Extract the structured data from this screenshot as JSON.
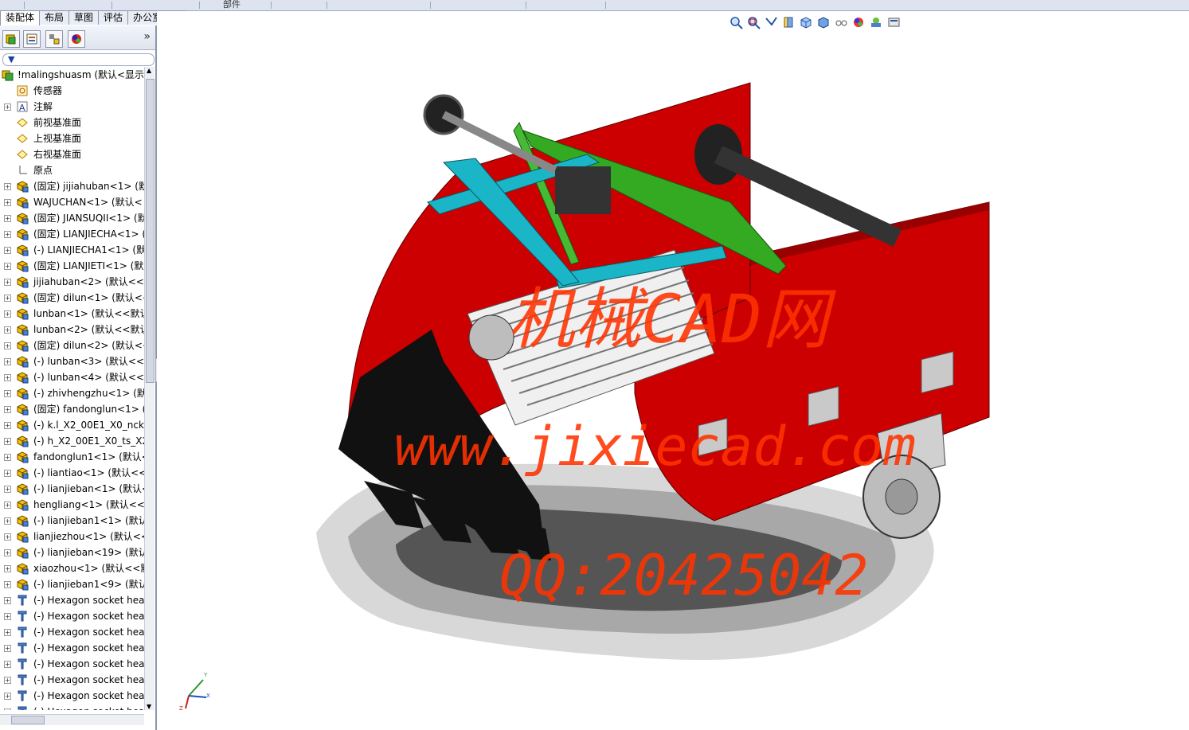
{
  "menu_strip": {
    "label": "部件"
  },
  "tabs": [
    {
      "label": "装配体",
      "active": true
    },
    {
      "label": "布局",
      "active": false
    },
    {
      "label": "草图",
      "active": false
    },
    {
      "label": "评估",
      "active": false
    },
    {
      "label": "办公室产品",
      "active": false
    }
  ],
  "tree": {
    "root": "!malingshuasm  (默认<显示",
    "items": [
      {
        "label": "传感器",
        "icon": "sensor-icon",
        "expand": false
      },
      {
        "label": "注解",
        "icon": "annotation-icon",
        "expand": true
      },
      {
        "label": "前视基准面",
        "icon": "plane-icon",
        "expand": false
      },
      {
        "label": "上视基准面",
        "icon": "plane-icon",
        "expand": false
      },
      {
        "label": "右视基准面",
        "icon": "plane-icon",
        "expand": false
      },
      {
        "label": "原点",
        "icon": "origin-icon",
        "expand": false
      },
      {
        "label": "(固定) jijiahuban<1> (默",
        "icon": "part-icon",
        "expand": true
      },
      {
        "label": "WAJUCHAN<1> (默认<",
        "icon": "part-icon",
        "expand": true
      },
      {
        "label": "(固定) JIANSUQII<1> (默",
        "icon": "part-icon",
        "expand": true
      },
      {
        "label": "(固定) LIANJIECHA<1> (",
        "icon": "part-icon",
        "expand": true
      },
      {
        "label": "(-) LIANJIECHA1<1> (默认",
        "icon": "part-icon",
        "expand": true
      },
      {
        "label": "(固定) LIANJIETI<1> (默",
        "icon": "part-icon",
        "expand": true
      },
      {
        "label": "jijiahuban<2> (默认<<默",
        "icon": "part-icon",
        "expand": true
      },
      {
        "label": "(固定) dilun<1> (默认<<",
        "icon": "part-icon",
        "expand": true
      },
      {
        "label": "lunban<1> (默认<<默认",
        "icon": "part-icon",
        "expand": true
      },
      {
        "label": "lunban<2> (默认<<默认",
        "icon": "part-icon",
        "expand": true
      },
      {
        "label": "(固定) dilun<2> (默认<<",
        "icon": "part-icon",
        "expand": true
      },
      {
        "label": "(-) lunban<3> (默认<<默",
        "icon": "part-icon",
        "expand": true
      },
      {
        "label": "(-) lunban<4> (默认<<默",
        "icon": "part-icon",
        "expand": true
      },
      {
        "label": "(-) zhivhengzhu<1> (默认",
        "icon": "part-icon",
        "expand": true
      },
      {
        "label": "(固定) fandonglun<1> (默",
        "icon": "part-icon",
        "expand": true
      },
      {
        "label": "(-) k.l_X2_00E1_X0_ncker",
        "icon": "part-icon",
        "expand": true
      },
      {
        "label": "(-) h_X2_00E1_X0_ts_X2_",
        "icon": "part-icon",
        "expand": true
      },
      {
        "label": "fandonglun1<1> (默认<",
        "icon": "part-icon",
        "expand": true
      },
      {
        "label": "(-) liantiao<1> (默认<<默",
        "icon": "part-icon",
        "expand": true
      },
      {
        "label": "(-) lianjieban<1> (默认<",
        "icon": "part-icon",
        "expand": true
      },
      {
        "label": "hengliang<1> (默认<<默",
        "icon": "part-icon",
        "expand": true
      },
      {
        "label": "(-) lianjieban1<1> (默认",
        "icon": "part-icon",
        "expand": true
      },
      {
        "label": "lianjiezhou<1> (默认<<",
        "icon": "part-icon",
        "expand": true
      },
      {
        "label": "(-) lianjieban<19> (默认",
        "icon": "part-icon",
        "expand": true
      },
      {
        "label": "xiaozhou<1> (默认<<默",
        "icon": "part-icon",
        "expand": true
      },
      {
        "label": "(-) lianjieban1<9> (默认",
        "icon": "part-icon",
        "expand": true
      },
      {
        "label": "(-) Hexagon socket hea",
        "icon": "toolbox-part-icon",
        "expand": true
      },
      {
        "label": "(-) Hexagon socket hea",
        "icon": "toolbox-part-icon",
        "expand": true
      },
      {
        "label": "(-) Hexagon socket hea",
        "icon": "toolbox-part-icon",
        "expand": true
      },
      {
        "label": "(-) Hexagon socket hea",
        "icon": "toolbox-part-icon",
        "expand": true
      },
      {
        "label": "(-) Hexagon socket hea",
        "icon": "toolbox-part-icon",
        "expand": true
      },
      {
        "label": "(-) Hexagon socket hea",
        "icon": "toolbox-part-icon",
        "expand": true
      },
      {
        "label": "(-) Hexagon socket hea",
        "icon": "toolbox-part-icon",
        "expand": true
      },
      {
        "label": "(-) Hexagon socket hea",
        "icon": "toolbox-part-icon",
        "expand": true
      }
    ]
  },
  "watermark": {
    "line1": "机械CAD网",
    "line2": "www.jixiecad.com",
    "line3": "QQ:20425042"
  },
  "triad": {
    "y": "Y",
    "x": "X",
    "z": "Z"
  },
  "colors": {
    "frame_red": "#cc0000",
    "frame_cyan": "#1bb5c8",
    "frame_green": "#33aa22",
    "blade_black": "#111111",
    "watermark": "#ff3300"
  }
}
